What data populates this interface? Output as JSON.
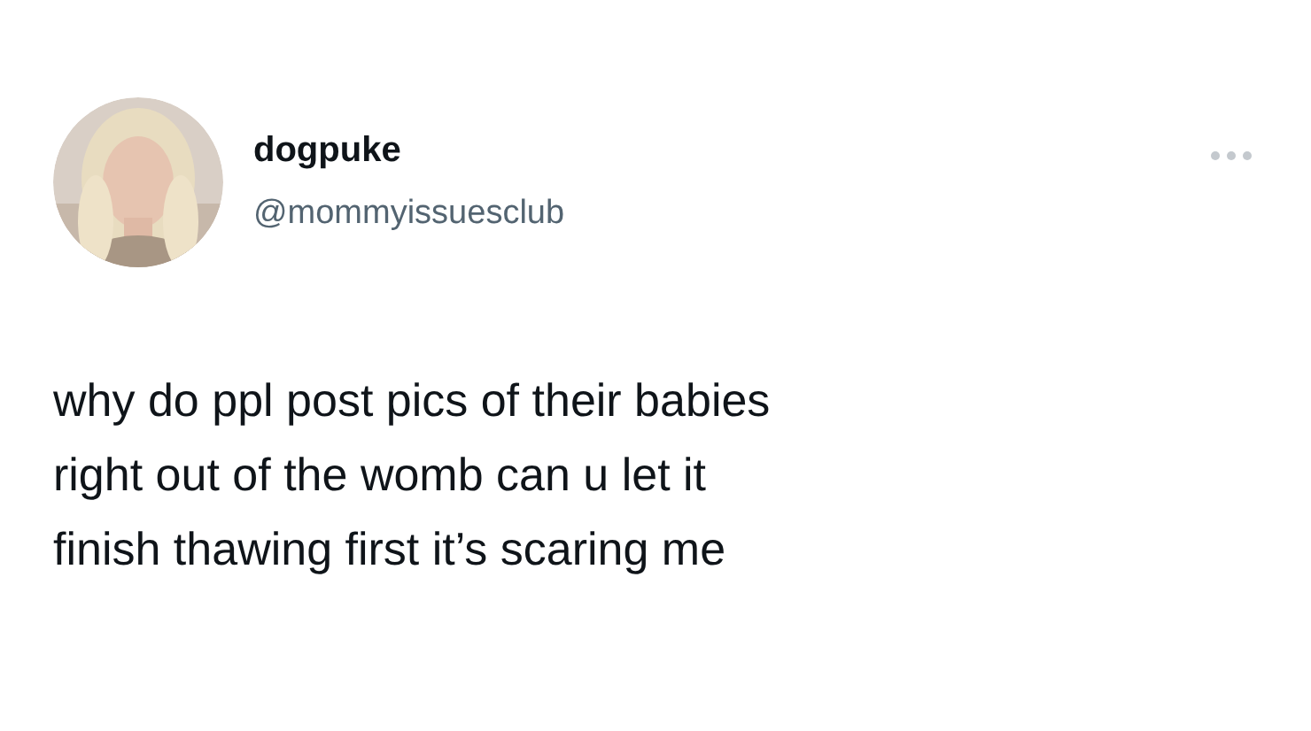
{
  "author": {
    "name": "dogpuke",
    "handle": "@mommyissuesclub"
  },
  "tweet": {
    "text": "why do ppl post pics of their babies\nright out of the womb can u let it\nfinish thawing first it’s scaring me"
  }
}
